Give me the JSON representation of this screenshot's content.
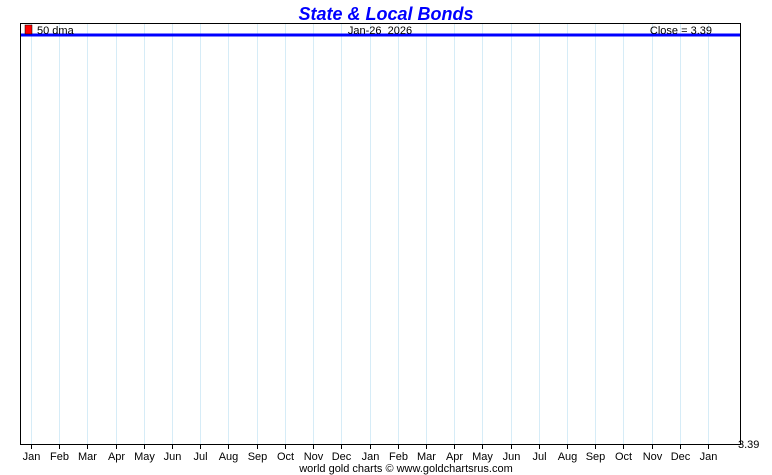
{
  "chart_data": {
    "type": "line",
    "title": "State & Local Bonds",
    "legend": [
      {
        "label": "50 dma",
        "color": "#ff0000"
      }
    ],
    "date_label": "Jan-26  2026",
    "close_label": "Close = 3.39",
    "xlabel": "",
    "ylabel": "",
    "x_ticks": [
      "Jan",
      "Feb",
      "Mar",
      "Apr",
      "May",
      "Jun",
      "Jul",
      "Aug",
      "Sep",
      "Oct",
      "Nov",
      "Dec",
      "Jan",
      "Feb",
      "Mar",
      "Apr",
      "May",
      "Jun",
      "Jul",
      "Aug",
      "Sep",
      "Oct",
      "Nov",
      "Dec",
      "Jan"
    ],
    "y_ticks": [
      "3.39"
    ],
    "ylim": [
      3.39,
      3.39
    ],
    "grid": true,
    "series": [
      {
        "name": "State & Local Bonds",
        "color": "#0000ff",
        "values": [
          3.39,
          3.39,
          3.39,
          3.39,
          3.39,
          3.39,
          3.39,
          3.39,
          3.39,
          3.39,
          3.39,
          3.39,
          3.39,
          3.39,
          3.39,
          3.39,
          3.39,
          3.39,
          3.39,
          3.39,
          3.39,
          3.39,
          3.39,
          3.39,
          3.39
        ]
      }
    ]
  },
  "footer": "world gold charts © www.goldchartsrus.com"
}
